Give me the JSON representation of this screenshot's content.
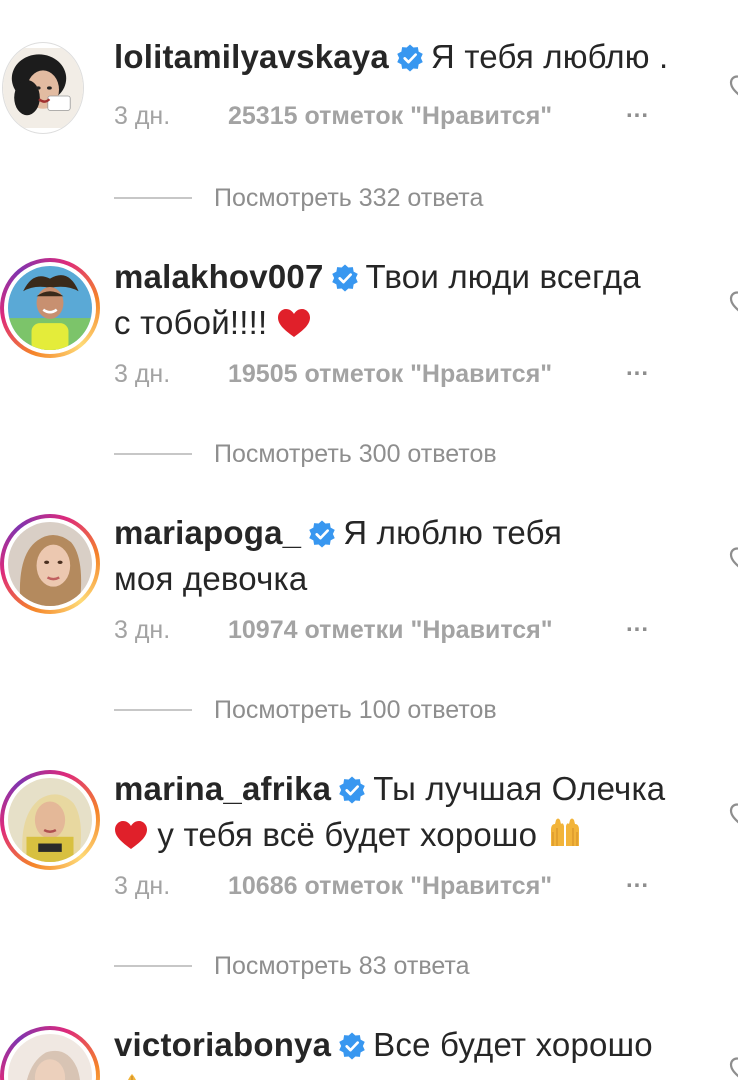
{
  "comments": [
    {
      "username": "lolitamilyavskaya",
      "text_line1": "Я тебя люблю .",
      "text_line2": "",
      "time": "3 дн.",
      "likes": "25315 отметок \"Нравится\"",
      "more": "...",
      "replies": "Посмотреть 332 ответа",
      "has_story_ring": false,
      "avatar_color": "#2a2a2a"
    },
    {
      "username": "malakhov007",
      "text_line1": "Твои люди всегда",
      "text_line2": "с тобой!!!!",
      "time": "3 дн.",
      "likes": "19505 отметок \"Нравится\"",
      "more": "...",
      "replies": "Посмотреть 300 ответов",
      "has_story_ring": true,
      "avatar_color": "#5aa9d6"
    },
    {
      "username": "mariapoga_",
      "text_line1": "Я люблю тебя",
      "text_line2": "моя девочка",
      "time": "3 дн.",
      "likes": "10974 отметки \"Нравится\"",
      "more": "...",
      "replies": "Посмотреть 100 ответов",
      "has_story_ring": true,
      "avatar_color": "#c9a58a"
    },
    {
      "username": "marina_afrika",
      "text_line1": "Ты лучшая Олечка",
      "text_line2": "у тебя всё будет хорошо",
      "time": "3 дн.",
      "likes": "10686 отметок \"Нравится\"",
      "more": "...",
      "replies": "Посмотреть 83 ответа",
      "has_story_ring": true,
      "avatar_color": "#d8c060"
    },
    {
      "username": "victoriabonya",
      "text_line1": "Все будет хорошо",
      "has_story_ring": true,
      "avatar_color": "#e6d2c4"
    }
  ],
  "colors": {
    "verified_blue": "#3897f0",
    "heart_red": "#e0202a",
    "meta_gray": "#a3a3a3",
    "text": "#262626"
  },
  "icons": {
    "verified": "verified-badge-icon",
    "heart": "red-heart-emoji",
    "raised_hands": "raising-hands-emoji",
    "folded_hands": "folded-hands-emoji",
    "like": "like-heart-outline-icon"
  }
}
